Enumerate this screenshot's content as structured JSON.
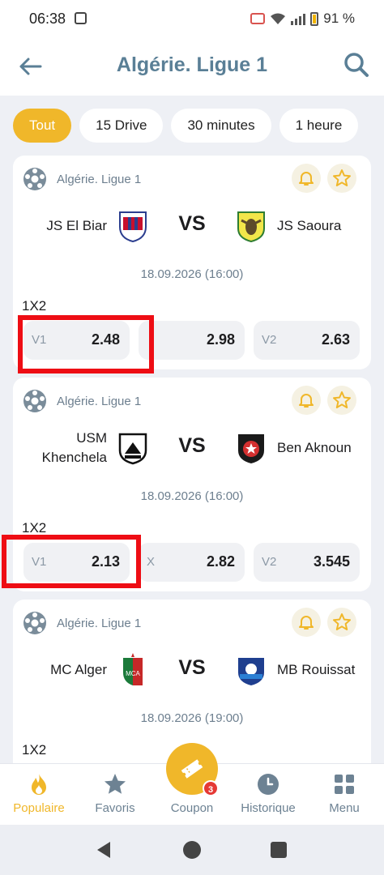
{
  "status": {
    "time": "06:38",
    "battery": "91 %"
  },
  "header": {
    "title": "Algérie. Ligue 1"
  },
  "filters": [
    "Tout",
    "15 Drive",
    "30 minutes",
    "1 heure"
  ],
  "matches": [
    {
      "league": "Algérie. Ligue 1",
      "home": "JS El Biar",
      "away": "JS Saoura",
      "vs": "VS",
      "date": "18.09.2026 (16:00)",
      "market": "1X2",
      "odds": [
        {
          "label": "V1",
          "value": "2.48"
        },
        {
          "label": "",
          "value": "2.98"
        },
        {
          "label": "V2",
          "value": "2.63"
        }
      ]
    },
    {
      "league": "Algérie. Ligue 1",
      "home": "USM Khenchela",
      "away": "Ben Aknoun",
      "vs": "VS",
      "date": "18.09.2026 (16:00)",
      "market": "1X2",
      "odds": [
        {
          "label": "V1",
          "value": "2.13"
        },
        {
          "label": "X",
          "value": "2.82"
        },
        {
          "label": "V2",
          "value": "3.545"
        }
      ]
    },
    {
      "league": "Algérie. Ligue 1",
      "home": "MC Alger",
      "away": "MB Rouissat",
      "vs": "VS",
      "date": "18.09.2026 (19:00)",
      "market": "1X2",
      "odds": []
    }
  ],
  "nav": [
    {
      "label": "Populaire",
      "icon": "flame-icon"
    },
    {
      "label": "Favoris",
      "icon": "star-icon"
    },
    {
      "label": "Coupon",
      "icon": "ticket-icon",
      "badge": "3"
    },
    {
      "label": "Historique",
      "icon": "clock-icon"
    },
    {
      "label": "Menu",
      "icon": "grid-icon"
    }
  ],
  "colors": {
    "accent": "#f0b72a",
    "title": "#5a7f96",
    "highlight": "#ee0d14"
  }
}
